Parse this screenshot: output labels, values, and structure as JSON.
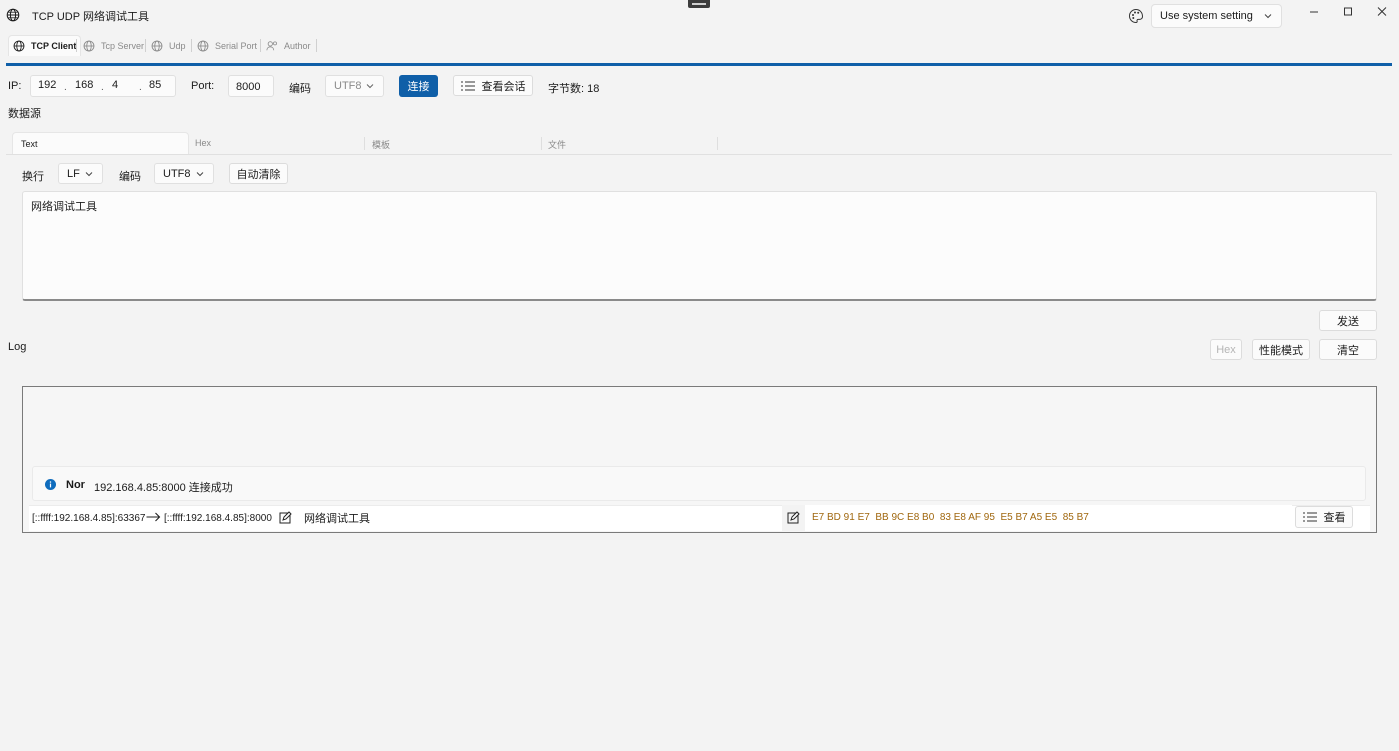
{
  "window": {
    "title": "TCP UDP 网络调试工具",
    "theme_select": "Use system setting"
  },
  "tabs": [
    {
      "label": "TCP Client",
      "icon": "globe-icon"
    },
    {
      "label": "Tcp Server",
      "icon": "globe-icon"
    },
    {
      "label": "Udp",
      "icon": "globe-icon"
    },
    {
      "label": "Serial Port",
      "icon": "globe-icon"
    },
    {
      "label": "Author",
      "icon": "person-icon"
    }
  ],
  "connection": {
    "ip_label": "IP:",
    "ip": [
      "192",
      "168",
      "4",
      "85"
    ],
    "port_label": "Port:",
    "port": "8000",
    "encoding_label": "编码",
    "encoding": "UTF8",
    "connect_label": "连接",
    "sessions_label": "查看会话",
    "byte_count": "字节数: 18"
  },
  "datasource": {
    "title": "数据源",
    "tabs": [
      "Text",
      "Hex",
      "模板",
      "文件"
    ],
    "newline_label": "换行",
    "newline": "LF",
    "encoding_label": "编码",
    "encoding": "UTF8",
    "auto_clear_label": "自动清除",
    "text": "网络调试工具",
    "send_label": "发送"
  },
  "log": {
    "title": "Log",
    "hex_label": "Hex",
    "perf_label": "性能模式",
    "clear_label": "清空",
    "entry": {
      "level": "Nor",
      "message": "192.168.4.85:8000 连接成功"
    },
    "message": {
      "from": "[::ffff:192.168.4.85]:63367",
      "to": "[::ffff:192.168.4.85]:8000",
      "text": "网络调试工具",
      "hex": "E7 BD 91 E7  BB 9C E8 B0  83 E8 AF 95  E5 B7 A5 E5  85 B7",
      "view_label": "查看"
    }
  },
  "colors": {
    "accent": "#0f5fa8",
    "hex_text": "#a0670e",
    "info": "#0f6cbd"
  }
}
